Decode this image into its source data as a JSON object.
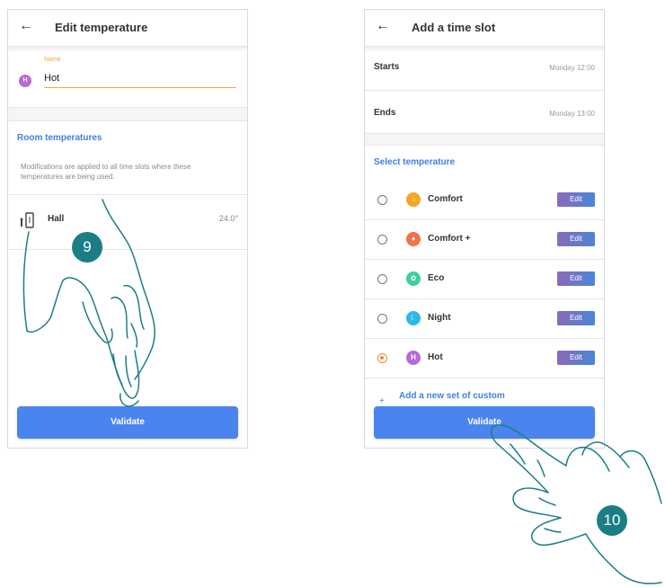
{
  "left_screen": {
    "header": {
      "back_icon": "arrow-left-icon",
      "title": "Edit temperature"
    },
    "name_label": "Name",
    "avatar_letter": "H",
    "name_value": "Hot",
    "section_title": "Room temperatures",
    "note": "Modifications are applied to all time slots where these temperatures are being used.",
    "room": {
      "icon": "thermostat-icon",
      "name": "Hall",
      "temperature": "24.0°"
    },
    "validate_label": "Validate"
  },
  "right_screen": {
    "header": {
      "back_icon": "arrow-left-icon",
      "title": "Add a time slot"
    },
    "starts_label": "Starts",
    "starts_value": "Monday 12:00",
    "ends_label": "Ends",
    "ends_value": "Monday 13:00",
    "section_title": "Select temperature",
    "temperatures": [
      {
        "name": "Comfort",
        "icon": "sun-icon",
        "color": "#f5a623",
        "selected": false,
        "edit_label": "Edit"
      },
      {
        "name": "Comfort +",
        "icon": "flame-icon",
        "color": "#f0734a",
        "selected": false,
        "edit_label": "Edit"
      },
      {
        "name": "Eco",
        "icon": "leaf-icon",
        "color": "#3ecf9a",
        "selected": false,
        "edit_label": "Edit"
      },
      {
        "name": "Night",
        "icon": "moon-icon",
        "color": "#2fb7e8",
        "selected": false,
        "edit_label": "Edit"
      },
      {
        "name": "Hot",
        "icon": "letter-h-icon",
        "letter": "H",
        "color": "#b86ad8",
        "selected": true,
        "edit_label": "Edit"
      }
    ],
    "add_custom": "Add a new set of custom",
    "validate_label": "Validate"
  },
  "steps": [
    "9",
    "10"
  ],
  "colors": {
    "accent_blue": "#4a84ee",
    "accent_orange": "#f5a33b",
    "step_badge": "#1b7e86"
  }
}
